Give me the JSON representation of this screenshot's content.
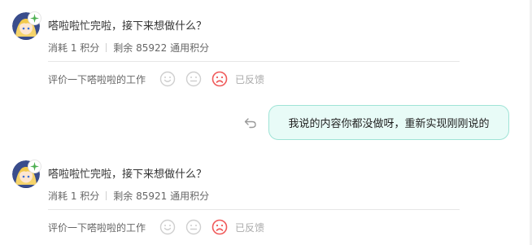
{
  "colors": {
    "bubble_bg": "#e8fbf7",
    "bubble_border": "#9fe3d6",
    "sad_face_active": "#f05a5a",
    "muted_text": "#666666"
  },
  "messages": [
    {
      "role": "assistant",
      "avatar_icon": "anime-girl-avatar",
      "badge_icon": "sparkle-badge-icon",
      "text": "嗒啦啦忙完啦，接下来想做什么？",
      "cost": "消耗 1 积分",
      "remaining": "剩余 85922 通用积分",
      "feedback_label": "评价一下嗒啦啦的工作",
      "feedback_status": "已反馈"
    },
    {
      "role": "user",
      "retry_icon": "retry-icon",
      "text": "我说的内容你都没做呀，重新实现刚刚说的"
    },
    {
      "role": "assistant",
      "avatar_icon": "anime-girl-avatar",
      "badge_icon": "sparkle-badge-icon",
      "text": "嗒啦啦忙完啦，接下来想做什么？",
      "cost": "消耗 1 积分",
      "remaining": "剩余 85921 通用积分",
      "feedback_label": "评价一下嗒啦啦的工作",
      "feedback_status": "已反馈"
    }
  ]
}
